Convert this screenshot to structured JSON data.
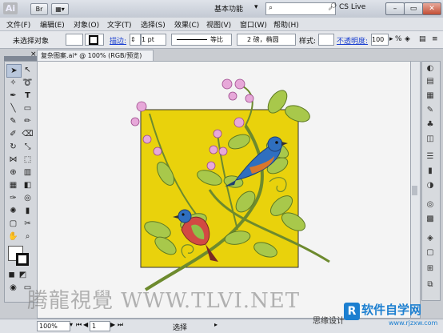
{
  "titlebar": {
    "app_logo": "Ai",
    "workspace": "基本功能",
    "cs_live": "CS Live",
    "window_buttons": [
      "–",
      "▭",
      "✕"
    ]
  },
  "menu": [
    "文件(F)",
    "编辑(E)",
    "对象(O)",
    "文字(T)",
    "选择(S)",
    "效果(C)",
    "视图(V)",
    "窗口(W)",
    "帮助(H)"
  ],
  "control": {
    "selection_label": "未选择对象",
    "stroke_link": "描边:",
    "stroke_weight": "1 pt",
    "line_style": "等比",
    "brush": "2 磅，椭圆",
    "style_label": "样式:",
    "opacity_link": "不透明度:",
    "opacity_value": "100",
    "opacity_unit": "%"
  },
  "document": {
    "tab_title": "复杂图案.ai* @ 100% (RGB/预览)"
  },
  "status": {
    "zoom": "100%",
    "page": "1",
    "mode": "选择"
  },
  "watermark": {
    "left_text": "腾龍視覺 WWW.TLVI.NET",
    "sub_text": "思缘设计",
    "logo_text": "软件自学网",
    "logo_url": "www.rjzxw.com"
  },
  "colors": {
    "artboard_fill": "#e9d20c",
    "bird_blue": "#2f6fbf",
    "bird_orange": "#d9772b",
    "leaf_green": "#a8c84b",
    "flower_pink": "#e7a8d9"
  }
}
